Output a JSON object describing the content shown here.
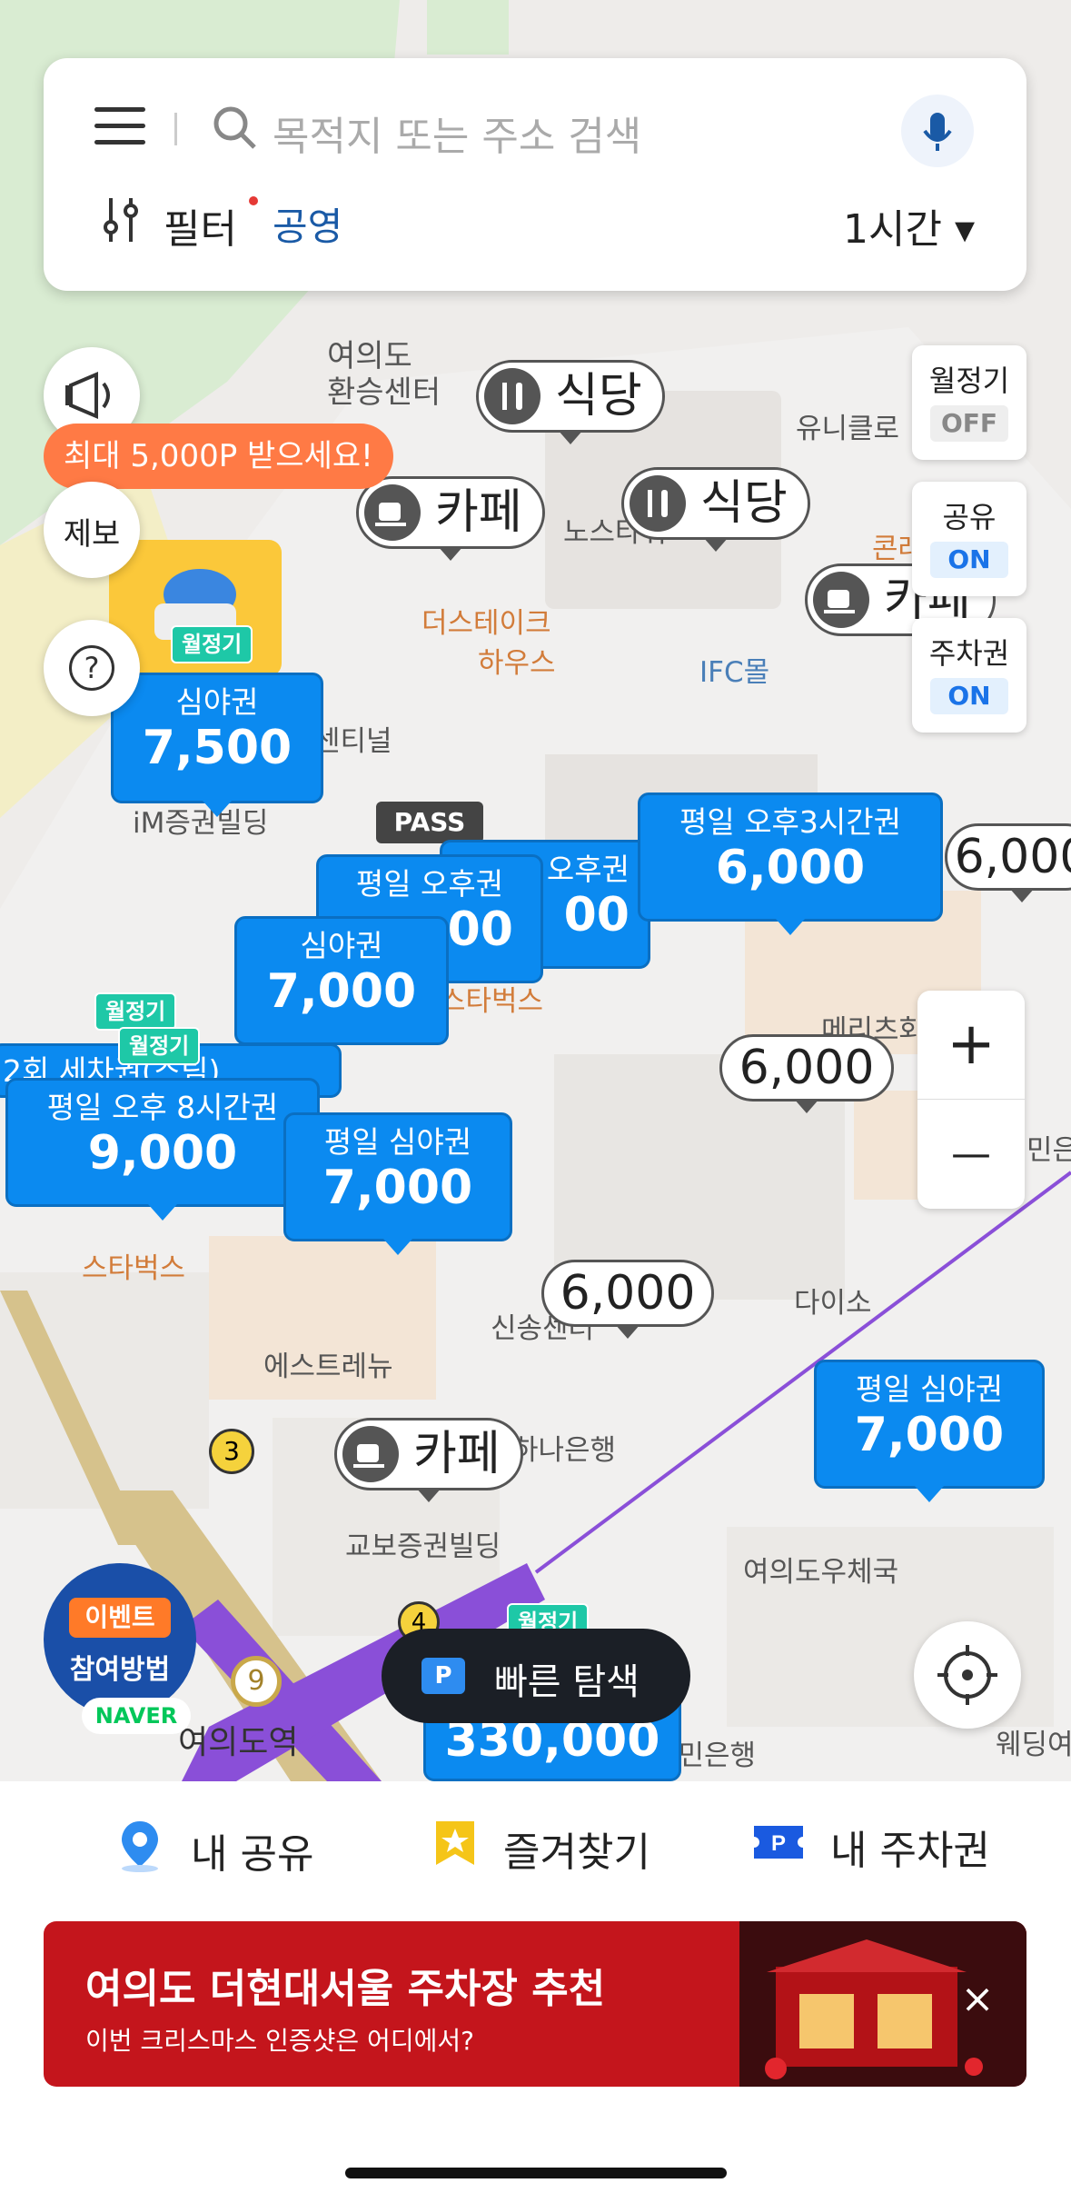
{
  "search": {
    "placeholder": "목적지 또는 주소 검색",
    "filter_label": "필터",
    "filter_public": "공영",
    "time_select": "1시간 ▾"
  },
  "side_left": {
    "promo": "최대 5,000P 받으세요!",
    "report_label": "제보",
    "help_symbol": "?"
  },
  "toggles": [
    {
      "title": "월정기",
      "state": "OFF"
    },
    {
      "title": "공유",
      "state": "ON"
    },
    {
      "title": "주차권",
      "state": "ON"
    }
  ],
  "zoom": {
    "plus": "+",
    "minus": "—"
  },
  "map_labels": [
    "여의도",
    "환승센터",
    "유니클로",
    "노스타워",
    "더스테이크",
    "하우스",
    "IFC몰",
    "콘래드",
    "iM증권빌딩",
    "센티널",
    "스타벅스",
    "스타벅스",
    "메리츠화재",
    "다이소",
    "신송센터",
    "에스트레뉴",
    "하나은행",
    "교보증권빌딩",
    "여의도우체국",
    "여의도역",
    "국민은행",
    "웨딩여",
    "민은"
  ],
  "poi_markers": [
    {
      "label": "식당"
    },
    {
      "label": "카페"
    },
    {
      "label": "식당"
    },
    {
      "label": "카페"
    },
    {
      "label": "카페"
    }
  ],
  "price_markers": [
    {
      "label": "심야권",
      "value": "7,500"
    },
    {
      "label": "평일 오후3시간권",
      "value": "6,000"
    },
    {
      "label": "평일 오후권",
      "value": "00"
    },
    {
      "label": "오후권",
      "value": "00"
    },
    {
      "label": "심야권",
      "value": "7,000"
    },
    {
      "label": "평일 오후 8시간권",
      "value": "9,000"
    },
    {
      "label": "평일 심야권",
      "value": "7,000"
    },
    {
      "label": "평일 심야권",
      "value": "7,000"
    },
    {
      "label": "",
      "value": "330,000"
    }
  ],
  "white_prices": [
    "6,000",
    "6,000",
    "6,000"
  ],
  "badges": [
    "월정기",
    "월정기",
    "월정기",
    "월정기"
  ],
  "pass_tag": "PASS",
  "partial_label": "2회 세차권(스팀)",
  "station_numbers": [
    "3",
    "4",
    "9"
  ],
  "event": {
    "line1": "이벤트",
    "line2": "참여방법",
    "naver": "NAVER"
  },
  "quick_nav": "빠른 탐색",
  "bottom_tabs": [
    {
      "label": "내 공유",
      "icon": "location-pin-icon"
    },
    {
      "label": "즐겨찾기",
      "icon": "star-icon"
    },
    {
      "label": "내 주차권",
      "icon": "parking-ticket-icon"
    }
  ],
  "banner": {
    "title": "여의도 더현대서울 주차장 추천",
    "subtitle": "이번 크리스마스 인증샷은 어디에서?",
    "close": "×"
  },
  "colors": {
    "accent": "#0b8af0",
    "banner": "#c4151c",
    "promo": "#ff7a45",
    "badge": "#1ec8a7",
    "subway_purple": "#8a4fd8"
  }
}
